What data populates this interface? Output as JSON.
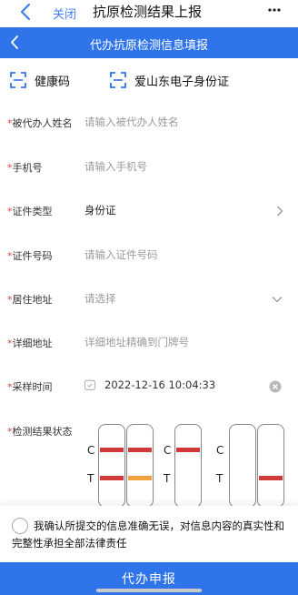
{
  "top_bar": {
    "close_label": "关闭",
    "title": "抗原检测结果上报",
    "more_icon": "more-dots-icon"
  },
  "header": {
    "title": "代办抗原检测信息填报"
  },
  "codes": [
    {
      "label": "健康码",
      "icon": "scan-icon"
    },
    {
      "label": "爱山东电子身份证",
      "icon": "scan-icon"
    }
  ],
  "form": {
    "required_mark": "*",
    "name": {
      "label": "被代办人姓名",
      "placeholder": "请输入被代办人姓名"
    },
    "phone": {
      "label": "手机号",
      "placeholder": "请输入手机号"
    },
    "id_type": {
      "label": "证件类型",
      "value": "身份证"
    },
    "id_number": {
      "label": "证件号码",
      "placeholder": "请输入证件号码"
    },
    "address": {
      "label": "居住地址",
      "placeholder": "请选择"
    },
    "detail_address": {
      "label": "详细地址",
      "placeholder": "详细地址精确到门牌号"
    },
    "sample_time": {
      "label": "采样时间",
      "value": "2022-12-16 10:04:33"
    },
    "result": {
      "label": "检测结果状态",
      "c_letter": "C",
      "t_letter": "T",
      "options": [
        {
          "c_line": true,
          "t_line": true,
          "t_color": "#e0463b"
        },
        {
          "c_line": false,
          "t_line": false,
          "t_color": ""
        },
        {
          "c_line": true,
          "t_line": false,
          "t_color": ""
        },
        {
          "c_line": false,
          "t_line": false,
          "t_color": ""
        }
      ]
    }
  },
  "confirm": {
    "text": "我确认所提交的信息准确无误，对信息内容的真实性和完整性承担全部法律责任"
  },
  "submit": {
    "label": "代办申报"
  },
  "colors": {
    "primary": "#2f74e9",
    "required": "#e0463b",
    "c_line": "#d0383a",
    "t_positive": "#d0383a",
    "t_faint": "#f0a33a"
  }
}
